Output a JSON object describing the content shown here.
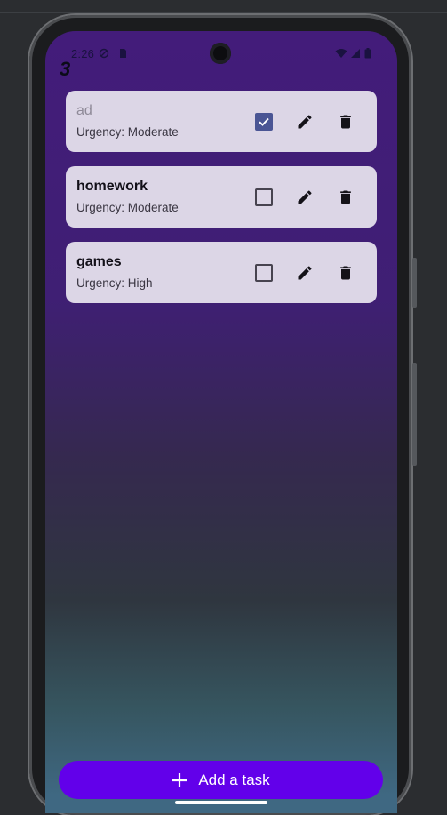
{
  "status_bar": {
    "time": "2:26",
    "icons": [
      "no-disturb-icon",
      "sim-icon",
      "wifi-icon",
      "cellular-icon",
      "battery-icon"
    ]
  },
  "header": {
    "task_count": "3"
  },
  "tasks": [
    {
      "title": "ad",
      "urgency": "Urgency: Moderate",
      "completed": true
    },
    {
      "title": "homework",
      "urgency": "Urgency: Moderate",
      "completed": false
    },
    {
      "title": "games",
      "urgency": "Urgency: High",
      "completed": false
    }
  ],
  "actions": {
    "edit_icon": "pencil-icon",
    "delete_icon": "trash-icon"
  },
  "fab": {
    "label": "Add a task",
    "icon": "plus-icon"
  },
  "colors": {
    "accent": "#6200ea",
    "card": "#dcd6e6",
    "checkbox_checked": "#4a5594"
  }
}
